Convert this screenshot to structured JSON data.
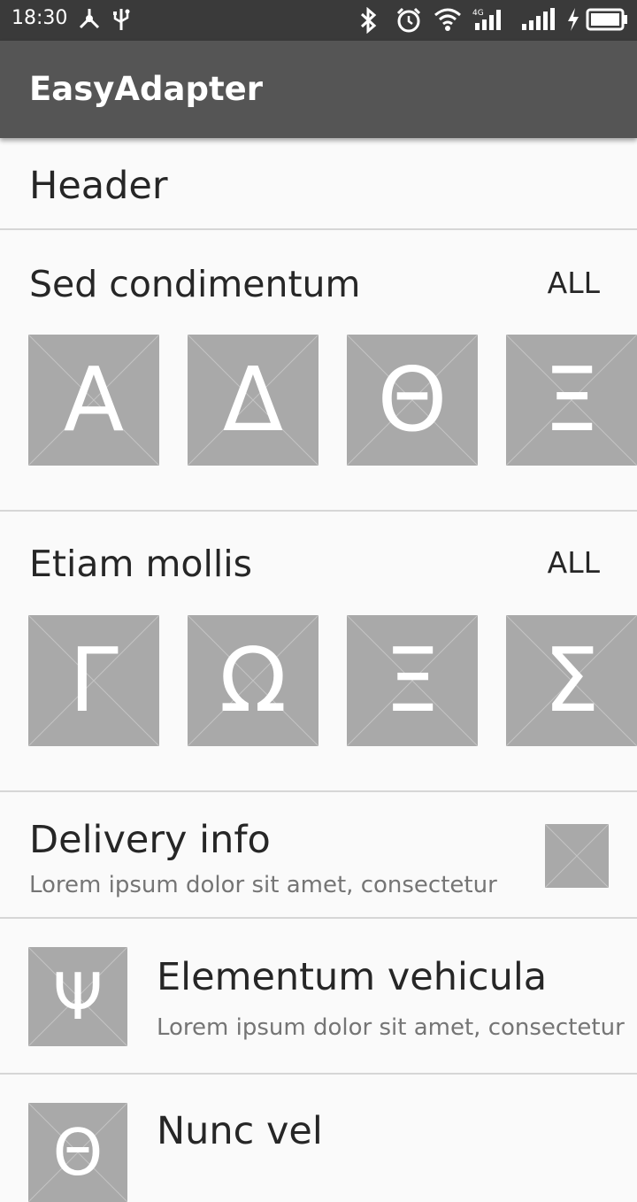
{
  "status_bar": {
    "time": "18:30",
    "left_icons": [
      "usb-share-icon",
      "usb-icon"
    ],
    "right_icons": [
      "bluetooth-icon",
      "alarm-icon",
      "wifi-icon",
      "signal-4g-icon",
      "signal-icon",
      "charging-icon",
      "battery-icon"
    ]
  },
  "app_bar": {
    "title": "EasyAdapter",
    "color": "#555555"
  },
  "header": {
    "text": "Header"
  },
  "sections": [
    {
      "title": "Sed condimentum",
      "action": "ALL",
      "tiles": [
        "Α",
        "Δ",
        "Θ",
        "Ξ"
      ]
    },
    {
      "title": "Etiam mollis",
      "action": "ALL",
      "tiles": [
        "Γ",
        "Ω",
        "Ξ",
        "Σ"
      ]
    }
  ],
  "delivery": {
    "title": "Delivery info",
    "subtitle": "Lorem ipsum dolor sit amet, consectetur"
  },
  "list_items": [
    {
      "glyph": "Ψ",
      "title": "Elementum vehicula",
      "subtitle": "Lorem ipsum dolor sit amet, consectetur"
    },
    {
      "glyph": "Θ",
      "title": "Nunc vel",
      "subtitle": ""
    }
  ],
  "colors": {
    "placeholder": "#a9a9a9",
    "status_bar": "#3a3a3a",
    "background": "#fafafa"
  }
}
